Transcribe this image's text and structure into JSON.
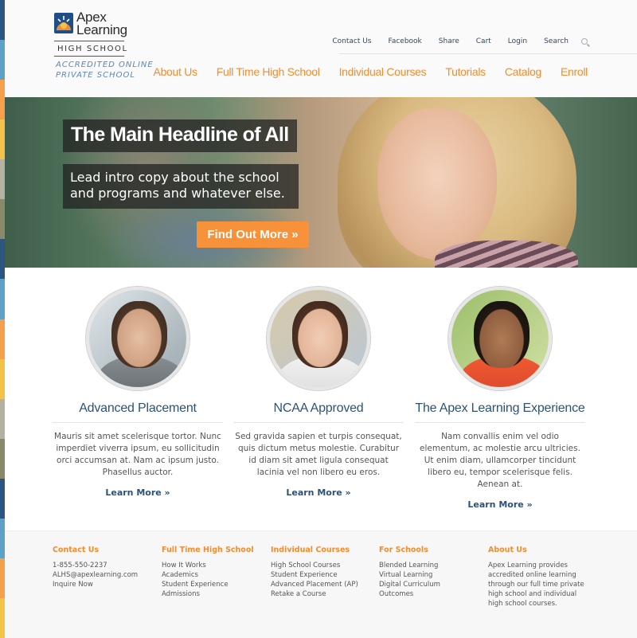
{
  "colors": {
    "accent": "#f28c2e",
    "navy": "#2c5278",
    "cta": "#f7923a",
    "strip": [
      "#2d5582",
      "#5da1c8",
      "#f6a04d",
      "#f2c24a",
      "#b4b0a2",
      "#8a8a6a",
      "#2d5582",
      "#5da1c8",
      "#f6a04d",
      "#f2c24a",
      "#b4b0a2",
      "#8a8a6a",
      "#2d5582",
      "#5da1c8",
      "#f6a04d",
      "#f2c24a"
    ]
  },
  "logo": {
    "name_line1": "Apex",
    "name_line2": "Learning",
    "school": "HIGH SCHOOL",
    "tag_line1": "ACCREDITED ONLINE",
    "tag_line2": "PRIVATE SCHOOL",
    "icon": "apex-sun-logo-icon"
  },
  "utility": {
    "items": [
      "Contact Us",
      "Facebook",
      "Share",
      "Cart",
      "Login",
      "Search"
    ],
    "search_icon": "search-icon"
  },
  "nav": {
    "items": [
      "About Us",
      "Full Time High School",
      "Individual Courses",
      "Tutorials",
      "Catalog",
      "Enroll"
    ]
  },
  "hero": {
    "headline": "The Main Headline of All",
    "intro": "Lead intro copy about the school and programs and whatever else.",
    "cta": "Find Out More »"
  },
  "features": [
    {
      "title": "Advanced Placement",
      "text": "Mauris sit amet scelerisque tortor. Nunc imperdiet viverra ipsum, eu sollicitudin orci accumsan at. Nam ac ipsum justo. Phasellus auctor.",
      "link": "Learn More »"
    },
    {
      "title": "NCAA Approved",
      "text": "Sed gravida sapien et turpis consequat, quis dictum metus molestie. Curabitur id diam sit amet ligula consequat lacinia vel non libero eu eros.",
      "link": "Learn More »"
    },
    {
      "title": "The Apex Learning Experience",
      "text": "Nam convallis enim vel odio elementum, ac molestie arcu ultricies. Ut enim diam, ullamcorper tincidunt libero eu, tempor scelerisque felis. Aenean at.",
      "link": "Learn More »"
    }
  ],
  "footer": {
    "contact": {
      "heading": "Contact Us",
      "items": [
        "1-855-550-2237",
        "ALHS@apexlearning.com",
        "Inquire Now"
      ]
    },
    "fulltime": {
      "heading": "Full Time High School",
      "items": [
        "How It Works",
        "Academics",
        "Student Experience",
        "Admissions"
      ]
    },
    "courses": {
      "heading": "Individual Courses",
      "items": [
        "High School Courses",
        "Student Experience",
        "Advanced Placement (AP)",
        "Retake a Course"
      ]
    },
    "schools": {
      "heading": "For Schools",
      "items": [
        "Blended Learning",
        "Virtual Learning",
        "Digital Curriculum",
        "Outcomes"
      ]
    },
    "about": {
      "heading": "About Us",
      "items": [
        "Apex Learning provides",
        "accredited online learning",
        "through our full time private",
        "high school and individual",
        "high school courses."
      ]
    }
  }
}
